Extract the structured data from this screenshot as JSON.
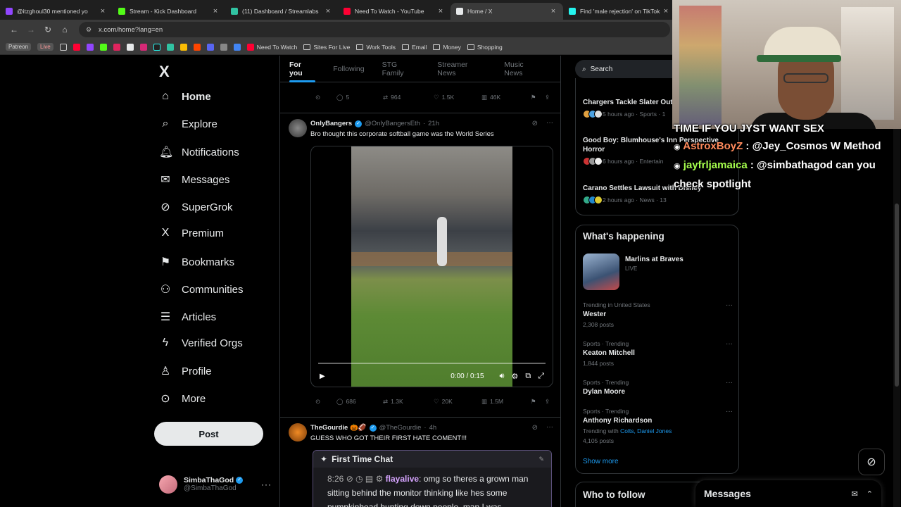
{
  "browser": {
    "tabs": [
      {
        "label": "@itzghoul30 mentioned yo",
        "color": "#9146ff",
        "active": false
      },
      {
        "label": "Stream - Kick Dashboard",
        "color": "#53fc18",
        "active": false
      },
      {
        "label": "(11) Dashboard / Streamlabs",
        "color": "#31c3a2",
        "active": false
      },
      {
        "label": "Need To Watch - YouTube",
        "color": "#ff0033",
        "active": false
      },
      {
        "label": "Home / X",
        "color": "#e7e9ea",
        "active": true
      },
      {
        "label": "Find 'male rejection' on TikTok",
        "color": "#25f4ee",
        "active": false
      }
    ],
    "close_glyph": "×",
    "url": "x.com/home?lang=en",
    "bookmarks": {
      "patreon": "Patreon",
      "live": "Live",
      "need_to_watch": "Need To Watch",
      "folders": [
        "Sites For Live",
        "Work Tools",
        "Email",
        "Money",
        "Shopping"
      ]
    }
  },
  "nav": {
    "logo": "X",
    "items": [
      {
        "label": "Home",
        "icon": "home-icon",
        "glyph": "⌂"
      },
      {
        "label": "Explore",
        "icon": "search-icon",
        "glyph": "⌕"
      },
      {
        "label": "Notifications",
        "icon": "bell-icon",
        "glyph": "♫"
      },
      {
        "label": "Messages",
        "icon": "envelope-icon",
        "glyph": "✉"
      },
      {
        "label": "SuperGrok",
        "icon": "grok-icon",
        "glyph": "⊘"
      },
      {
        "label": "Premium",
        "icon": "x-icon",
        "glyph": "X"
      },
      {
        "label": "Bookmarks",
        "icon": "bookmark-icon",
        "glyph": "⚑"
      },
      {
        "label": "Communities",
        "icon": "people-icon",
        "glyph": "⚇"
      },
      {
        "label": "Articles",
        "icon": "article-icon",
        "glyph": "☰"
      },
      {
        "label": "Verified Orgs",
        "icon": "lightning-icon",
        "glyph": "ϟ"
      },
      {
        "label": "Profile",
        "icon": "person-icon",
        "glyph": "♙"
      },
      {
        "label": "More",
        "icon": "more-circle-icon",
        "glyph": "⊙"
      }
    ],
    "post_button": "Post",
    "account": {
      "name": "SimbaThaGod",
      "handle": "@SimbaThaGod"
    }
  },
  "feed": {
    "tabs": [
      "For you",
      "Following",
      "STG Family",
      "Streamer News",
      "Music News"
    ],
    "active_tab": "For you",
    "top_actions": {
      "replies": "5",
      "reposts": "964",
      "likes": "1.5K",
      "views": "46K"
    },
    "tweets": [
      {
        "name": "OnlyBangers",
        "handle": "@OnlyBangersEth",
        "time": "21h",
        "text": "Bro thought this corporate softball game was the World Series",
        "video_time": "0:00 / 0:15",
        "actions": {
          "replies": "686",
          "reposts": "1.3K",
          "likes": "20K",
          "views": "1.5M"
        }
      },
      {
        "name": "TheGourdie 🎃🏈",
        "handle": "@TheGourdie",
        "time": "4h",
        "text": "GUESS WHO GOT THEIR FIRST HATE COMENT!!!",
        "card": {
          "title": "First Time Chat",
          "time": "8:26",
          "user": "flayalive",
          "message": ": omg so theres a grown man sitting behind the monitor thinking like hes some pumpkinhead hunting down people. man I was"
        }
      }
    ]
  },
  "right": {
    "search_placeholder": "Search",
    "news": [
      {
        "title": "Chargers Tackle Slater Out",
        "meta": "5 hours ago · Sports · 1"
      },
      {
        "title": "Good Boy: Blumhouse's Inn Perspective Horror",
        "meta": "6 hours ago · Entertain"
      },
      {
        "title": "Carano Settles Lawsuit with Disney",
        "meta": "2 hours ago · News · 13"
      }
    ],
    "whats_happening": {
      "title": "What's happening",
      "live": {
        "title": "Marlins at Braves",
        "status": "LIVE"
      },
      "trends": [
        {
          "context": "Trending in United States",
          "title": "Wester",
          "posts": "2,308 posts"
        },
        {
          "context": "Sports · Trending",
          "title": "Keaton Mitchell",
          "posts": "1,844 posts"
        },
        {
          "context": "Sports · Trending",
          "title": "Dylan Moore",
          "posts": ""
        },
        {
          "context": "Sports · Trending",
          "title": "Anthony Richardson",
          "with_label": "Trending with",
          "with_links": "Colts, Daniel Jones",
          "posts": "4,105 posts"
        }
      ],
      "show_more": "Show more"
    },
    "who_to_follow": "Who to follow"
  },
  "messages_drawer": {
    "title": "Messages"
  },
  "stream_chat": [
    {
      "user": "",
      "text": "TIME IF YOU JYST WANT SEX"
    },
    {
      "user": "AstroxBoyZ",
      "text": " : @Jey_Cosmos W Method"
    },
    {
      "user": "jayfrljamaica",
      "text": " : @simbathagod can you"
    },
    {
      "user": "",
      "text": "check spotlight"
    }
  ]
}
